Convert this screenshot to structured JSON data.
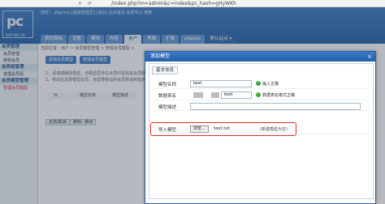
{
  "browser": {
    "nav_icons": [
      "✕",
      "⟳",
      "☆"
    ],
    "url": "/index.php?m=admin&c=index&pc_hash=gHyWKh"
  },
  "header": {
    "logo_mark": "pc",
    "logo_sub": "PHPCMS.CN",
    "greeting": "您好！ phpcms [超级管理员] [退出] 站点首页 会员中心 搜索",
    "tabs": [
      "我的面板",
      "设置",
      "模块",
      "内容",
      "用户",
      "界面",
      "扩展",
      "phpsso",
      "默认站点 ▾"
    ],
    "active_tab_index": 4
  },
  "sidebar": {
    "sections": [
      {
        "title": "会员管理",
        "items": [
          "会员管理",
          "审核会员"
        ]
      },
      {
        "title": "会员组管理",
        "items": [
          "管理会员组"
        ]
      },
      {
        "title": "会员模型管理",
        "items": [
          "管理会员模型"
        ]
      }
    ]
  },
  "main": {
    "breadcrumb": "当前位置：用户 > 会员模型管理 > 管理会员模型 >",
    "buttons": [
      "添加会员模型",
      "管理会员模型"
    ],
    "tips": [
      "1、请谨慎删除模型，当模型里存在会员时请将其会员移动到其他模型。",
      "2、移动后选择模型会员、将需要移动的会员移动到指定模型。"
    ],
    "table_headers": [
      "ID",
      "模型名称",
      "模型描述"
    ],
    "table_buttons": [
      "全选/取消",
      "删除",
      "移动"
    ]
  },
  "modal": {
    "title": "添加模型",
    "close": "×",
    "section_tab": "基本信息",
    "fields": {
      "name": {
        "label": "模型名称",
        "value": "test",
        "status": "输入正确"
      },
      "table": {
        "label": "数据表名",
        "value": "test",
        "status": "数据表名格式正确"
      },
      "desc": {
        "label": "模型描述",
        "value": ""
      },
      "import": {
        "label": "导入模型",
        "browse": "浏览...",
        "file": "test.txt",
        "hint": "(新建模型为空)"
      }
    }
  }
}
